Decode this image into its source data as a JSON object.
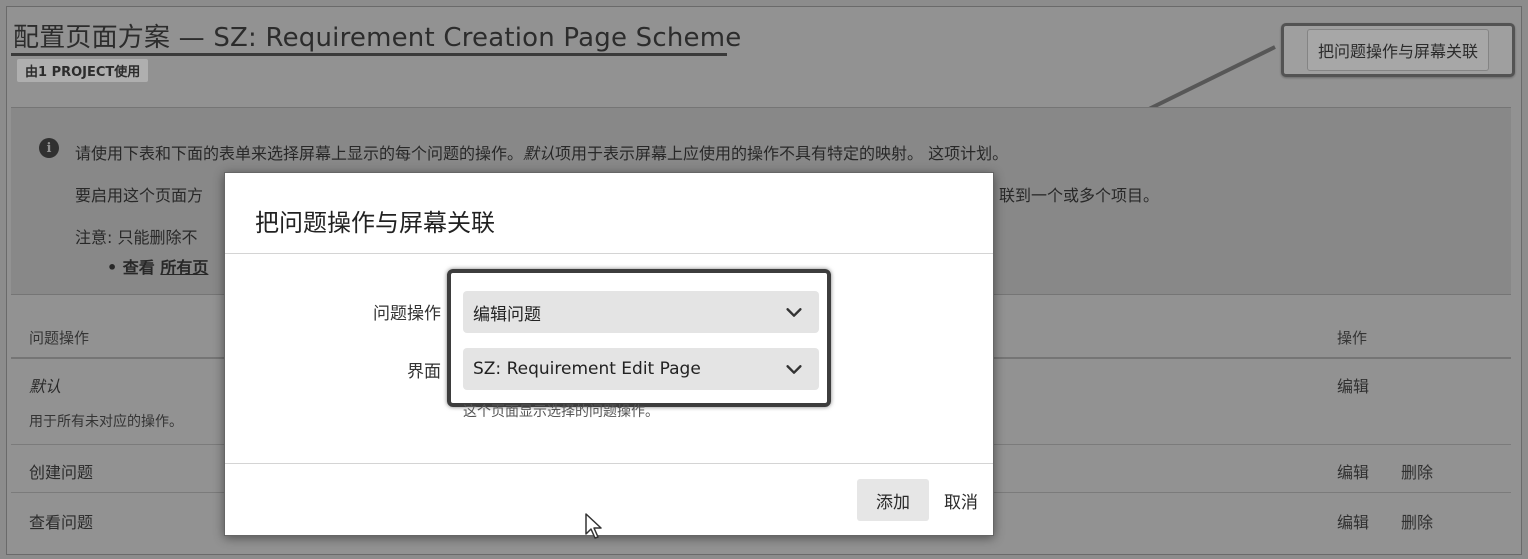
{
  "page": {
    "title": "配置页面方案 — SZ: Requirement Creation Page Scheme",
    "used_by": "由1 PROJECT使用",
    "associate_button": "把问题操作与屏幕关联"
  },
  "info": {
    "line1_prefix": "请使用下表和下面的表单来选择屏幕上显示的每个问题的操作。",
    "line1_italic": "默认",
    "line1_suffix": "项用于表示屏幕上应使用的操作不具有特定的映射。 这项计划。",
    "line2_left": "要启用这个页面方",
    "line2_right": "联到一个或多个项目。",
    "line3": "注意: 只能删除不",
    "bullet_prefix": "查看",
    "bullet_link": "所有页"
  },
  "table": {
    "col_ops": "问题操作",
    "col_actions": "操作",
    "rows": [
      {
        "name": "默认",
        "desc": "用于所有未对应的操作。",
        "edit": "编辑",
        "delete": ""
      },
      {
        "name": "创建问题",
        "desc": "",
        "edit": "编辑",
        "delete": "删除"
      },
      {
        "name": "查看问题",
        "desc": "",
        "edit": "编辑",
        "delete": "删除"
      }
    ]
  },
  "modal": {
    "title": "把问题操作与屏幕关联",
    "op_label": "问题操作",
    "op_value": "编辑问题",
    "screen_label": "界面",
    "screen_value": "SZ: Requirement Edit Page",
    "hint": "这个页面显示选择的问题操作。",
    "add_button": "添加",
    "cancel_button": "取消"
  },
  "icons": {
    "info": "info-icon",
    "chevron": "chevron-down-icon",
    "cursor": "mouse-pointer-icon"
  }
}
